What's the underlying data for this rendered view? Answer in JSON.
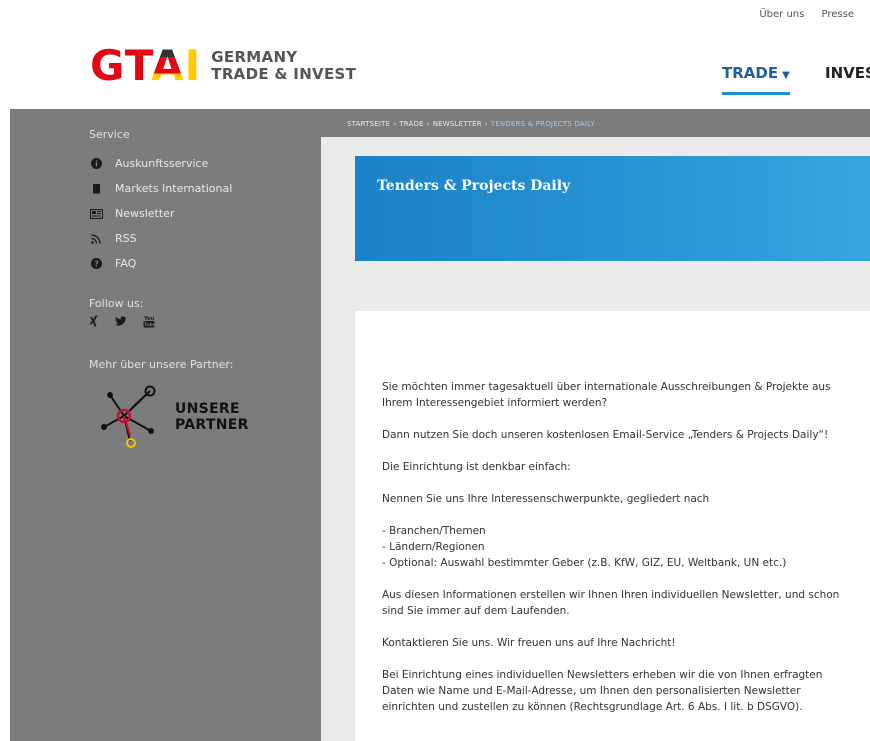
{
  "header": {
    "top_links": [
      "Über uns",
      "Presse"
    ],
    "logo": {
      "mark": "GTAI",
      "line1": "GERMANY",
      "line2": "TRADE & INVEST"
    },
    "nav": {
      "active": "TRADE",
      "next": "INVES"
    }
  },
  "sidebar": {
    "service_title": "Service",
    "items": [
      {
        "label": "Auskunftsservice",
        "icon": "info-icon"
      },
      {
        "label": "Markets International",
        "icon": "book-icon"
      },
      {
        "label": "Newsletter",
        "icon": "newspaper-icon"
      },
      {
        "label": "RSS",
        "icon": "rss-icon"
      },
      {
        "label": "FAQ",
        "icon": "question-icon"
      }
    ],
    "follow_label": "Follow us:",
    "social": [
      "xing-icon",
      "twitter-icon",
      "youtube-icon"
    ],
    "partner_label": "Mehr über unsere Partner:",
    "partner_line1": "UNSERE",
    "partner_line2": "PARTNER"
  },
  "breadcrumb": [
    "STARTSEITE",
    "TRADE",
    "NEWSLETTER",
    "TENDERS & PROJECTS DAILY"
  ],
  "hero": {
    "title": "Tenders & Projects Daily"
  },
  "article": {
    "p1": "Sie möchten immer tagesaktuell über internationale Ausschreibungen & Projekte aus Ihrem Interessengebiet informiert werden?",
    "p2": "Dann nutzen Sie doch unseren kostenlosen Email-Service „Tenders & Projects Daily“!",
    "p3": "Die Einrichtung ist denkbar einfach:",
    "p4": "Nennen Sie uns Ihre Interessenschwerpunkte, gegliedert nach",
    "list": [
      "- Branchen/Themen",
      "- Ländern/Regionen",
      "- Optional: Auswahl bestimmter Geber (z.B. KfW, GIZ, EU, Weltbank, UN etc.)"
    ],
    "p5": "Aus diesen Informationen erstellen wir Ihnen Ihren individuellen Newsletter, und schon sind Sie immer auf dem Laufenden.",
    "p6": "Kontaktieren Sie uns. Wir freuen uns auf Ihre Nachricht!",
    "p7": "Bei Einrichtung eines individuellen Newsletters erheben wir die von Ihnen erfragten Daten wie Name und E-Mail-Adresse, um Ihnen den personalisierten Newsletter einrichten und zustellen zu können (Rechtsgrundlage Art. 6 Abs. I lit. b DSGVO)."
  },
  "colors": {
    "accent": "#1f8fd6",
    "hero": "#1b82c9",
    "sidebar_bg": "#7c7c7c"
  }
}
